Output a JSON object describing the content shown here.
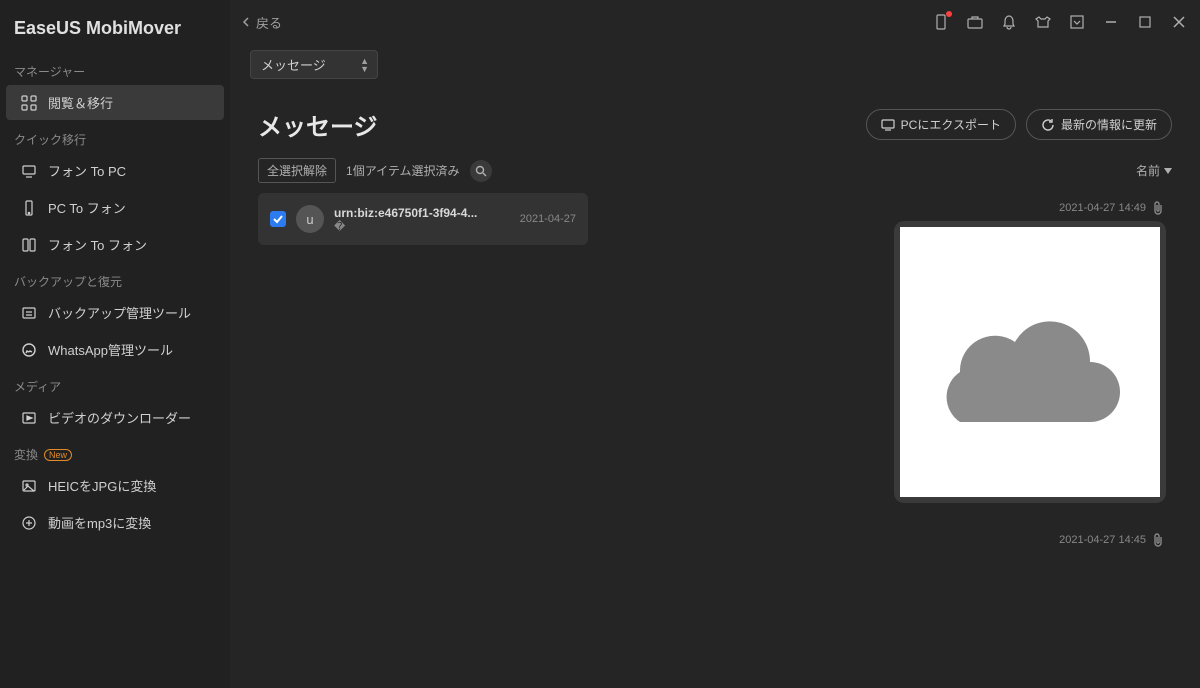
{
  "app_title": "EaseUS MobiMover",
  "back_label": "戻る",
  "sidebar": {
    "sections": [
      {
        "label": "マネージャー",
        "items": [
          {
            "icon": "grid-icon",
            "label": "閲覧＆移行",
            "active": true
          }
        ]
      },
      {
        "label": "クイック移行",
        "items": [
          {
            "icon": "phone-pc-icon",
            "label": "フォン To PC"
          },
          {
            "icon": "pc-phone-icon",
            "label": "PC To フォン"
          },
          {
            "icon": "phone-phone-icon",
            "label": "フォン To フォン"
          }
        ]
      },
      {
        "label": "バックアップと復元",
        "items": [
          {
            "icon": "backup-icon",
            "label": "バックアップ管理ツール"
          },
          {
            "icon": "whatsapp-icon",
            "label": "WhatsApp管理ツール"
          }
        ]
      },
      {
        "label": "メディア",
        "items": [
          {
            "icon": "video-dl-icon",
            "label": "ビデオのダウンローダー"
          }
        ]
      },
      {
        "label": "変換",
        "badge": "New",
        "items": [
          {
            "icon": "image-convert-icon",
            "label": "HEICをJPGに変換"
          },
          {
            "icon": "audio-convert-icon",
            "label": "動画をmp3に変換"
          }
        ]
      }
    ]
  },
  "dropdown_selected": "メッセージ",
  "page_title": "メッセージ",
  "export_btn": "PCにエクスポート",
  "refresh_btn": "最新の情報に更新",
  "deselect_all": "全選択解除",
  "selected_count": "1個アイテム選択済み",
  "sort_label": "名前",
  "thread": {
    "avatar_letter": "u",
    "name": "urn:biz:e46750f1-3f94-4...",
    "date": "2021-04-27",
    "snippet": "�"
  },
  "messages": [
    {
      "ts": "2021-04-27 14:49"
    },
    {
      "ts": "2021-04-27 14:45"
    }
  ]
}
